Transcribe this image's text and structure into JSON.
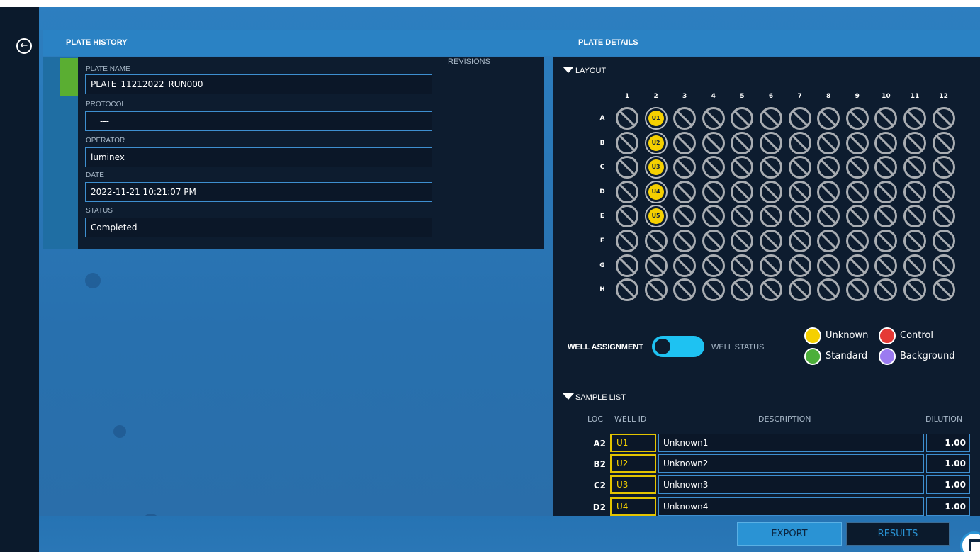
{
  "header": {
    "plate_history_title": "PLATE HISTORY",
    "plate_details_title": "PLATE DETAILS"
  },
  "plate_history": {
    "revisions_label": "REVISIONS",
    "fields": {
      "plate_name": {
        "label": "PLATE NAME",
        "value": "PLATE_11212022_RUN000"
      },
      "protocol": {
        "label": "PROTOCOL",
        "value": "---"
      },
      "operator": {
        "label": "OPERATOR",
        "value": "luminex"
      },
      "date": {
        "label": "DATE",
        "value": "2022-11-21 10:21:07 PM"
      },
      "status": {
        "label": "STATUS",
        "value": "Completed"
      }
    }
  },
  "layout": {
    "section_title": "LAYOUT",
    "columns": [
      "1",
      "2",
      "3",
      "4",
      "5",
      "6",
      "7",
      "8",
      "9",
      "10",
      "11",
      "12"
    ],
    "rows": [
      "A",
      "B",
      "C",
      "D",
      "E",
      "F",
      "G",
      "H"
    ],
    "assigned_wells": {
      "A2": "U1",
      "B2": "U2",
      "C2": "U3",
      "D2": "U4",
      "E2": "U5"
    }
  },
  "toggle": {
    "left_label": "WELL ASSIGNMENT",
    "right_label": "WELL STATUS"
  },
  "legend": {
    "unknown": {
      "label": "Unknown",
      "color": "#f5d000"
    },
    "control": {
      "label": "Control",
      "color": "#e53935"
    },
    "standard": {
      "label": "Standard",
      "color": "#4caf3a"
    },
    "background": {
      "label": "Background",
      "color": "#9b7bf0"
    }
  },
  "sample_list": {
    "section_title": "SAMPLE LIST",
    "headers": {
      "loc": "LOC",
      "well_id": "WELL ID",
      "description": "DESCRIPTION",
      "dilution": "DILUTION"
    },
    "rows": [
      {
        "loc": "A2",
        "well_id": "U1",
        "description": "Unknown1",
        "dilution": "1.00"
      },
      {
        "loc": "B2",
        "well_id": "U2",
        "description": "Unknown2",
        "dilution": "1.00"
      },
      {
        "loc": "C2",
        "well_id": "U3",
        "description": "Unknown3",
        "dilution": "1.00"
      },
      {
        "loc": "D2",
        "well_id": "U4",
        "description": "Unknown4",
        "dilution": "1.00"
      }
    ]
  },
  "buttons": {
    "export": "EXPORT",
    "results": "RESULTS"
  }
}
